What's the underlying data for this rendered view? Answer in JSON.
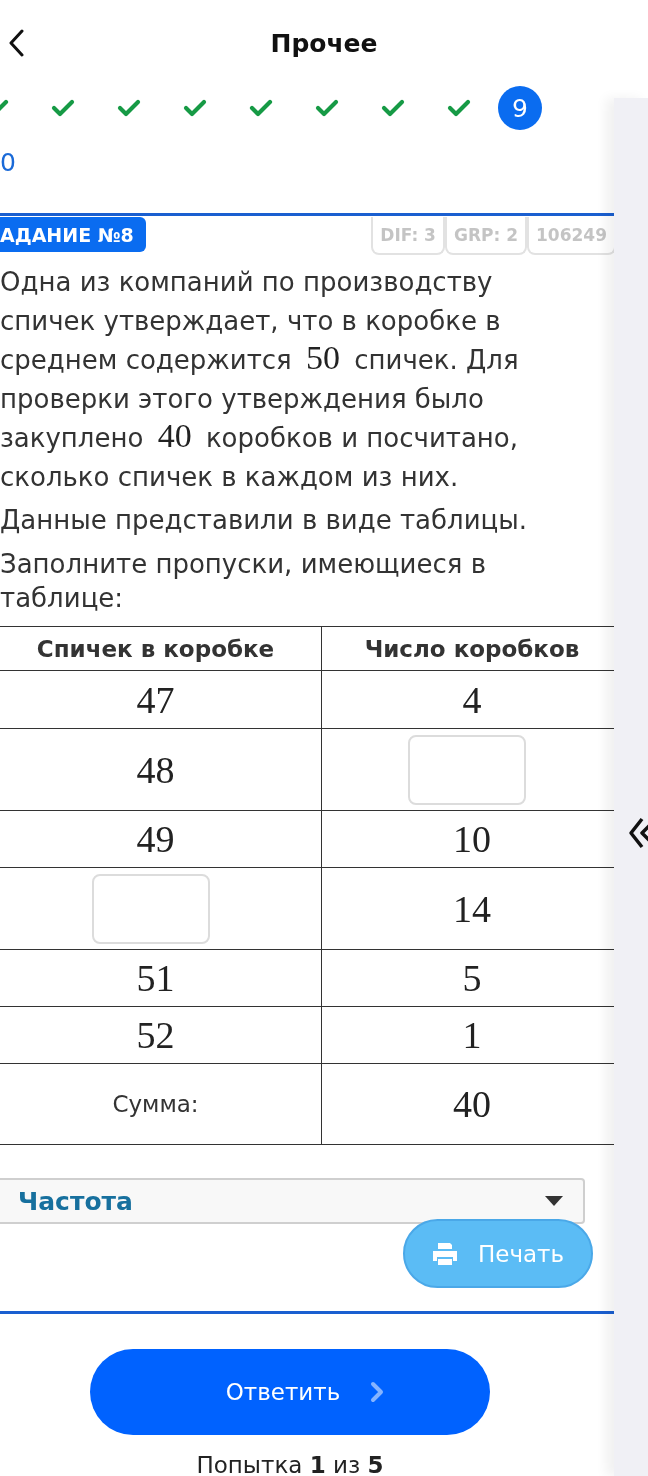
{
  "header": {
    "title": "Прочее"
  },
  "progress": {
    "steps": [
      {
        "selected": false
      },
      {
        "selected": false
      },
      {
        "selected": false
      },
      {
        "selected": false
      },
      {
        "selected": false
      },
      {
        "selected": false
      },
      {
        "selected": false
      },
      {
        "selected": false
      },
      {
        "label": "9",
        "selected": true
      }
    ]
  },
  "link_text": "0",
  "task": {
    "badge": "АДАНИЕ №8",
    "meta": [
      "DIF: 3",
      "GRP: 2",
      "106249"
    ],
    "paragraphs": [
      [
        {
          "kind": "text",
          "text": "Одна из компаний по производству спичек утверждает, что в коробке в среднем содержится"
        },
        {
          "kind": "math",
          "text": "50"
        },
        {
          "kind": "text",
          "text": "спичек. Для проверки этого утверждения было закуплено"
        },
        {
          "kind": "math",
          "text": "40"
        },
        {
          "kind": "text",
          "text": "коробков и посчитано, сколько спичек в каждом из них."
        }
      ],
      [
        {
          "kind": "text",
          "text": "Данные представили в виде таблицы."
        }
      ],
      [
        {
          "kind": "text",
          "text": "Заполните пропуски, имеющиеся в таблице:"
        }
      ]
    ],
    "table": {
      "columns": [
        "Спичек в коробке",
        "Число коробков"
      ],
      "rows": [
        [
          {
            "kind": "number",
            "text": "47"
          },
          {
            "kind": "number",
            "text": "4"
          }
        ],
        [
          {
            "kind": "number",
            "text": "48"
          },
          {
            "kind": "input"
          }
        ],
        [
          {
            "kind": "number",
            "text": "49"
          },
          {
            "kind": "number",
            "text": "10"
          }
        ],
        [
          {
            "kind": "input"
          },
          {
            "kind": "number",
            "text": "14"
          }
        ],
        [
          {
            "kind": "number",
            "text": "51"
          },
          {
            "kind": "number",
            "text": "5"
          }
        ],
        [
          {
            "kind": "number",
            "text": "52"
          },
          {
            "kind": "number",
            "text": "1"
          }
        ],
        [
          {
            "kind": "label",
            "text": "Сумма:"
          },
          {
            "kind": "number",
            "text": "40"
          }
        ]
      ]
    },
    "dropdown": {
      "value": "Частота"
    },
    "print_button": "Печать"
  },
  "answer_button": "Ответить",
  "attempt": "Попытка **1** из **5**"
}
